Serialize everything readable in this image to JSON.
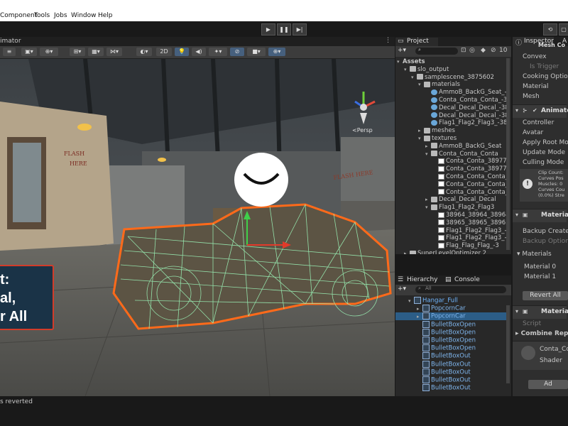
{
  "menu": {
    "items": [
      "Component",
      "Tools",
      "Jobs",
      "Window",
      "Help"
    ]
  },
  "playbar": {
    "play": "▶",
    "pause": "❚❚",
    "step": "▶|",
    "history": "⟲",
    "layers": "▢"
  },
  "scene": {
    "tab_label": "imator",
    "persp_label": "<Persp",
    "toggle_2d": "2D",
    "overlay_text": {
      "line1": "t:",
      "line2": "al,",
      "line3": "r All"
    }
  },
  "project": {
    "tab_label": "Project",
    "search_placeholder": "",
    "hidden_count": "10",
    "tree": [
      {
        "label": "Assets",
        "indent": 0,
        "icon": "none",
        "arrow": "open",
        "bold": true
      },
      {
        "label": "slo_output",
        "indent": 1,
        "icon": "folder",
        "arrow": "open"
      },
      {
        "label": "samplescene_3875602",
        "indent": 2,
        "icon": "folder",
        "arrow": "open"
      },
      {
        "label": "materials",
        "indent": 3,
        "icon": "folder",
        "arrow": "open"
      },
      {
        "label": "AmmoB_BackG_Seat_-3",
        "indent": 4,
        "icon": "mat",
        "arrow": "none"
      },
      {
        "label": "Conta_Conta_Conta_-3",
        "indent": 4,
        "icon": "mat",
        "arrow": "none"
      },
      {
        "label": "Decal_Decal_Decal_-38",
        "indent": 4,
        "icon": "mat",
        "arrow": "none"
      },
      {
        "label": "Decal_Decal_Decal_-38",
        "indent": 4,
        "icon": "mat",
        "arrow": "none"
      },
      {
        "label": "Flag1_Flag2_Flag3_-38",
        "indent": 4,
        "icon": "mat",
        "arrow": "none"
      },
      {
        "label": "meshes",
        "indent": 3,
        "icon": "folder",
        "arrow": "closed"
      },
      {
        "label": "textures",
        "indent": 3,
        "icon": "folder",
        "arrow": "open"
      },
      {
        "label": "AmmoB_BackG_Seat",
        "indent": 4,
        "icon": "folder",
        "arrow": "closed"
      },
      {
        "label": "Conta_Conta_Conta",
        "indent": 4,
        "icon": "folder",
        "arrow": "open"
      },
      {
        "label": "Conta_Conta_38977_",
        "indent": 5,
        "icon": "tex",
        "arrow": "none"
      },
      {
        "label": "Conta_Conta_38977_",
        "indent": 5,
        "icon": "tex",
        "arrow": "none"
      },
      {
        "label": "Conta_Conta_Conta_",
        "indent": 5,
        "icon": "tex",
        "arrow": "none"
      },
      {
        "label": "Conta_Conta_Conta_",
        "indent": 5,
        "icon": "tex",
        "arrow": "none"
      },
      {
        "label": "Conta_Conta_Conta_",
        "indent": 5,
        "icon": "tex",
        "arrow": "none"
      },
      {
        "label": "Decal_Decal_Decal",
        "indent": 4,
        "icon": "folder",
        "arrow": "closed"
      },
      {
        "label": "Flag1_Flag2_Flag3",
        "indent": 4,
        "icon": "folder",
        "arrow": "open"
      },
      {
        "label": "38964_38964_38964",
        "indent": 5,
        "icon": "tex",
        "arrow": "none"
      },
      {
        "label": "38965_38965_38965",
        "indent": 5,
        "icon": "tex",
        "arrow": "none"
      },
      {
        "label": "Flag1_Flag2_Flag3_-3",
        "indent": 5,
        "icon": "tex",
        "arrow": "none"
      },
      {
        "label": "Flag1_Flag2_Flag3_-3",
        "indent": 5,
        "icon": "tex",
        "arrow": "none"
      },
      {
        "label": "Flag_Flag_Flag_-3",
        "indent": 5,
        "icon": "tex",
        "arrow": "none"
      },
      {
        "label": "SuperLevelOptimizer 2",
        "indent": 1,
        "icon": "folder",
        "arrow": "closed"
      }
    ]
  },
  "hierarchy": {
    "tab_label": "Hierarchy",
    "console_tab": "Console",
    "search_placeholder": "All",
    "items": [
      {
        "label": "Hangar_Full",
        "indent": 0,
        "arrow": "open",
        "selected": false
      },
      {
        "label": "PopcornCar",
        "indent": 1,
        "arrow": "closed",
        "selected": false
      },
      {
        "label": "PopcornCar",
        "indent": 1,
        "arrow": "closed",
        "selected": true
      },
      {
        "label": "BulletBoxOpen",
        "indent": 1,
        "arrow": "none",
        "selected": false
      },
      {
        "label": "BulletBoxOpen",
        "indent": 1,
        "arrow": "none",
        "selected": false
      },
      {
        "label": "BulletBoxOpen",
        "indent": 1,
        "arrow": "none",
        "selected": false
      },
      {
        "label": "BulletBoxOpen",
        "indent": 1,
        "arrow": "none",
        "selected": false
      },
      {
        "label": "BulletBoxOut",
        "indent": 1,
        "arrow": "none",
        "selected": false
      },
      {
        "label": "BulletBoxOut",
        "indent": 1,
        "arrow": "none",
        "selected": false
      },
      {
        "label": "BulletBoxOut",
        "indent": 1,
        "arrow": "none",
        "selected": false
      },
      {
        "label": "BulletBoxOut",
        "indent": 1,
        "arrow": "none",
        "selected": false
      },
      {
        "label": "BulletBoxOut",
        "indent": 1,
        "arrow": "none",
        "selected": false
      }
    ]
  },
  "inspector": {
    "tab_label": "Inspector",
    "tab2_label": "A",
    "mesh_collider_header": "Mesh Co",
    "mesh_collider_rows": [
      "Convex",
      "Is Trigger",
      "Cooking Options",
      "Material",
      "Mesh"
    ],
    "animator_header": "Animator",
    "animator_rows": [
      "Controller",
      "Avatar",
      "Apply Root Motio",
      "Update Mode",
      "Culling Mode"
    ],
    "info_lines": [
      "Clip Count:",
      "Curves Pos",
      "Muscles: 0",
      "Curves Cou",
      "(0.0%) Stre"
    ],
    "material_header": "Materia",
    "material_rows": [
      "Backup Created",
      "Backup Option"
    ],
    "materials_label": "Materials",
    "material_list": [
      "Material 0",
      "Material 1"
    ],
    "revert_all": "Revert All",
    "material2_header": "Material",
    "material2_rows": [
      "Script",
      "Combine Repor"
    ],
    "conta_label": "Conta_Co",
    "shader_label": "Shader",
    "add_label": "Ad"
  },
  "status": {
    "message": "s reverted"
  },
  "colors": {
    "wire": "#9af0b4",
    "outline": "#ff6a1a",
    "selection": "#2c5d87",
    "accent": "#3b79c4"
  }
}
